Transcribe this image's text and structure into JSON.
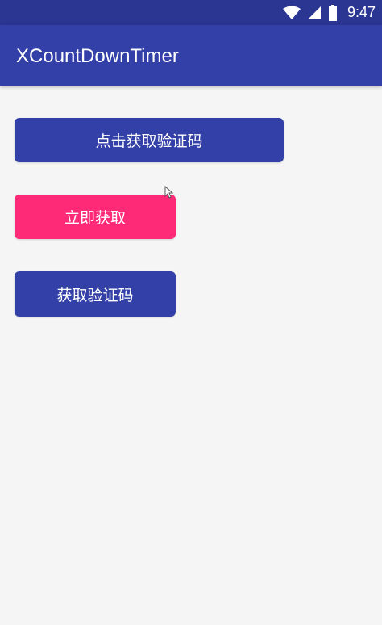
{
  "status_bar": {
    "time": "9:47",
    "icons": [
      "wifi-icon",
      "cell-signal-icon",
      "battery-icon"
    ]
  },
  "app_bar": {
    "title": "XCountDownTimer"
  },
  "buttons": [
    {
      "label": "点击获取验证码",
      "color": "#3340a7"
    },
    {
      "label": "立即获取",
      "color": "#fe2a77"
    },
    {
      "label": "获取验证码",
      "color": "#3340a7"
    }
  ],
  "colors": {
    "status_bar": "#2b3592",
    "primary": "#3340a7",
    "accent": "#fe2a77",
    "background": "#f5f5f5"
  }
}
